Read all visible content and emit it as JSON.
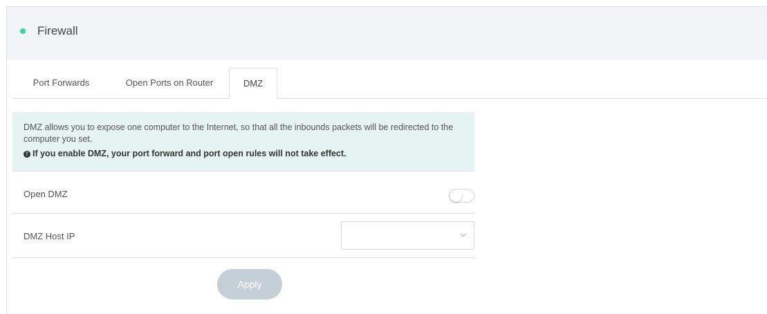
{
  "header": {
    "title": "Firewall",
    "status_color": "#33d6a6"
  },
  "tabs": [
    {
      "label": "Port Forwards",
      "active": false
    },
    {
      "label": "Open Ports on Router",
      "active": false
    },
    {
      "label": "DMZ",
      "active": true
    }
  ],
  "notice": {
    "text": "DMZ allows you to expose one computer to the Internet, so that all the inbounds packets will be redirected to the computer you set.",
    "warning_icon": "info-circle-icon",
    "warning": "If you enable DMZ, your port forward and port open rules will not take effect."
  },
  "settings": {
    "open_dmz": {
      "label": "Open DMZ",
      "enabled": false
    },
    "dmz_host_ip": {
      "label": "DMZ Host IP",
      "value": ""
    }
  },
  "actions": {
    "apply_label": "Apply"
  }
}
